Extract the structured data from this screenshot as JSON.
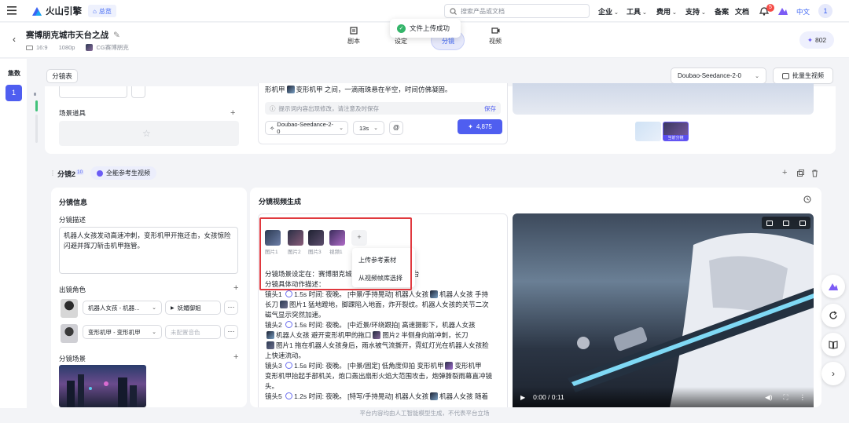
{
  "nav": {
    "brand": "火山引擎",
    "home": "总览",
    "search_placeholder": "搜索产品或文档",
    "links": [
      {
        "label": "企业",
        "has_menu": true
      },
      {
        "label": "工具",
        "has_menu": true
      },
      {
        "label": "费用",
        "has_menu": true
      },
      {
        "label": "支持",
        "has_menu": true
      },
      {
        "label": "备案",
        "has_menu": false
      },
      {
        "label": "文档",
        "has_menu": false
      }
    ],
    "notif_count": "5",
    "lang": "中文",
    "avatar": "1"
  },
  "toast": {
    "text": "文件上传成功"
  },
  "header": {
    "title": "赛博朋克城市天台之战",
    "ratio": "16:9",
    "resolution": "1080p",
    "style": "CG赛博朋克",
    "steps": [
      {
        "label": "剧本",
        "icon": "script-icon"
      },
      {
        "label": "设定",
        "icon": "settings-icon"
      },
      {
        "label": "分镜",
        "icon": "storyboard-icon",
        "active": true
      },
      {
        "label": "视频",
        "icon": "video-icon"
      }
    ],
    "credits": "802"
  },
  "sidebar": {
    "title": "集数",
    "episode": "1"
  },
  "toolbar": {
    "storyboard_tab": "分镜表",
    "model_select": "Doubao-Seedance-2-0",
    "batch_button": "批量生视频"
  },
  "shot1": {
    "scene_props_label": "场景道具",
    "script_tail": "形机甲",
    "script_tail2": "变形机甲 之间，一滴雨珠悬在半空，时间仿佛凝固。",
    "hint": "提示词内容出现修改，请注意及时保存",
    "save": "保存",
    "model": "Doubao-Seedance-2-0",
    "duration": "13s",
    "mention": "@",
    "generate_cost": "4,875",
    "output_badge": "当前分镜"
  },
  "shot2": {
    "title": "分镜2",
    "count": "10",
    "mode": "全能参考生视频",
    "info_title": "分镜信息",
    "desc_label": "分镜描述",
    "desc": "机器人女孩发动高速冲刺，变形机甲开拖还击，女孩惊险闪避并挥刀斩击机甲拖管。",
    "roles_label": "出镜角色",
    "roles": [
      {
        "name": "机器人女孩 - 机器...",
        "voice": "妩媚御姐"
      },
      {
        "name": "变形机甲 - 变形机甲",
        "voice": "未配置音色"
      }
    ],
    "scene_label": "分镜场景",
    "gen_title": "分镜视频生成",
    "refs": [
      {
        "label": "图片1",
        "color": "#3a4660"
      },
      {
        "label": "图片2",
        "color": "#5b4a6e"
      },
      {
        "label": "图片3",
        "color": "#4a3d57"
      },
      {
        "label": "视频1",
        "color": "#6b5a8a"
      }
    ],
    "add": "+",
    "menu": [
      "上传参考素材",
      "从视频帧库选择"
    ],
    "script_lines": {
      "l1a": "分镜场景设定在：赛博朋克城",
      "l1b": "城市天台",
      "l2": "分镜具体动作描述：",
      "s1a": "镜头1",
      "s1t": "1.5s",
      "s1b": "时间: 夜晚。 [中景/手持晃动] 机器人女孩",
      "s1c": "机器人女孩",
      "s1d": "手持",
      "s1e": "长刀",
      "s1f": "图片1",
      "s1g": "猛地蹬地，脚踝陷入地面，炸开裂纹。机器人女孩的关节二次",
      "s1h": "磁气显示突然加速。",
      "s2a": "镜头2",
      "s2t": "1.5s",
      "s2b": "时间: 夜晚。 [中近景/环绕跟拍] 高速摄影下，",
      "s2c": "机器人女孩",
      "s2d": "机器人女孩",
      "s2e": "避开变形机甲的拖口",
      "s2f": "图片2",
      "s2g": "半侧身向前冲刺，长刀",
      "s2h": "图片1",
      "s2i": "拖在机器人女孩身后，雨水被气流撕开，霓虹灯光在机器人女孩脸",
      "s2j": "上快速流动。",
      "s3a": "镜头3",
      "s3t": "1.5s",
      "s3b": "时间: 夜晚。 [中景/固定] 低角度仰拍 变形机甲",
      "s3c": "变形机甲",
      "s3d": "变形机甲抬起手部机关，炮口轰出扇形火焰大范围攻击，炮弹撕裂雨幕直冲镜",
      "s3e": "头。",
      "s4": "镜头5",
      "s4t": "1.2s",
      "s4b": "时间: 夜晚。 [特写/手持晃动] 机器人女孩",
      "s4c": "机器人女孩",
      "s4d": "随着"
    },
    "video_time": "0:00 / 0:11"
  },
  "footer": "平台内容均由人工智能模型生成，不代表平台立场"
}
